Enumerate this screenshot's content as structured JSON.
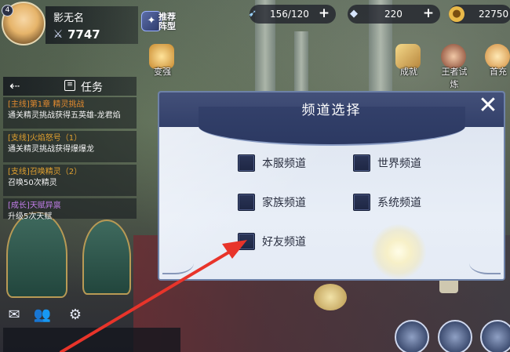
{
  "player": {
    "level": "4",
    "name": "影无名",
    "power_icon": "crossed-swords-icon",
    "power": "7747"
  },
  "lineup_button": {
    "label": "推荐阵型"
  },
  "resources": {
    "energy": {
      "icon": "energy-icon",
      "value": "156/120"
    },
    "diamond": {
      "icon": "diamond-icon",
      "value": "220"
    },
    "gold": {
      "icon": "gold-coin-icon",
      "value": "22750"
    }
  },
  "top_icons": {
    "strengthen": "变强",
    "achievement": "成就",
    "king_trial": "王者试炼",
    "first_charge": "首充"
  },
  "task_panel": {
    "title": "任务",
    "items": [
      {
        "tag": "[主线]",
        "name": "第1章 精灵挑战",
        "desc": "通关精灵挑战获得五英雄-龙君焰",
        "type": "main"
      },
      {
        "tag": "[支线]",
        "name": "火焰怒号（1）",
        "desc": "通关精灵挑战获得爆爆龙",
        "type": "branch"
      },
      {
        "tag": "[支线]",
        "name": "召唤精灵（2）",
        "desc": "召唤50次精灵",
        "type": "branch"
      },
      {
        "tag": "[成长]",
        "name": "天赋异禀",
        "desc": "升级5次天赋",
        "type": "long"
      }
    ]
  },
  "dialog": {
    "title": "频道选择",
    "close_icon": "close-icon",
    "channels": [
      {
        "id": "server",
        "label": "本服频道"
      },
      {
        "id": "world",
        "label": "世界频道"
      },
      {
        "id": "family",
        "label": "家族频道"
      },
      {
        "id": "system",
        "label": "系统频道"
      },
      {
        "id": "friend",
        "label": "好友频道"
      }
    ]
  },
  "colors": {
    "dialog_header": "#3a4670",
    "dialog_body": "#e6ecf5",
    "checkbox": "#232d4d",
    "annotation_arrow": "#e8342a"
  }
}
